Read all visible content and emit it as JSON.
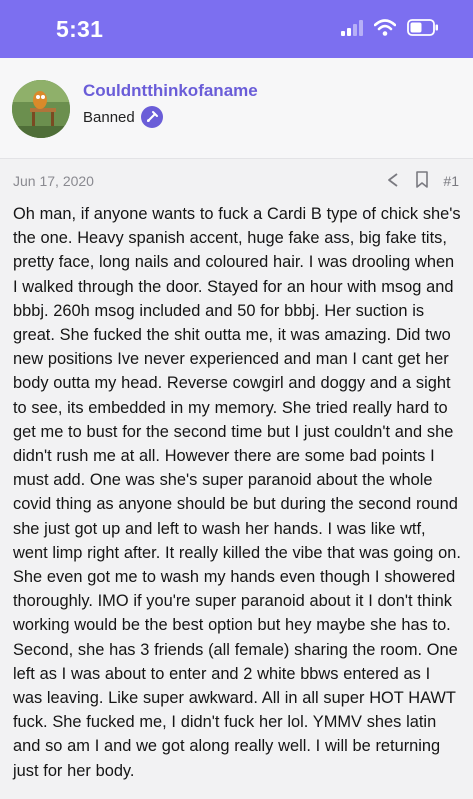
{
  "status_bar": {
    "time": "5:31",
    "icons": [
      "signal-icon",
      "wifi-icon",
      "battery-icon"
    ]
  },
  "profile": {
    "username": "Couldntthinkofaname",
    "role": "Banned",
    "badge_icon": "moderator-badge-icon",
    "accent_color": "#6a5dd8"
  },
  "post": {
    "date": "Jun 17, 2020",
    "post_number": "#1",
    "action_icons": [
      "share-icon",
      "bookmark-icon"
    ],
    "body": "Oh man, if anyone wants to fuck a Cardi B type of chick she's the one. Heavy spanish accent, huge fake ass, big fake tits, pretty face, long nails and coloured hair. I was drooling when I walked through the door. Stayed for an hour with msog and bbbj. 260h msog included and 50 for bbbj. Her suction is great. She fucked the shit outta me, it was amazing. Did two new positions Ive never experienced and man I cant get her body outta my head. Reverse cowgirl and doggy and a sight to see, its embedded in my memory. She tried really hard to get me to bust for the second time but I just couldn't and she didn't rush me at all. However there are some bad points I must add. One was she's super paranoid about the whole covid thing as anyone should be but during the second round she just got up and left to wash her hands. I was like wtf, went limp right after. It really killed the vibe that was going on. She even got me to wash my hands even though I showered thoroughly. IMO if you're super paranoid about it I don't think working would be the best option but hey maybe she has to. Second, she has 3 friends (all female) sharing the room. One left as I was about to enter and 2 white bbws entered as I was leaving. Like super awkward. All in all super HOT HAWT fuck. She fucked me, I didn't fuck her lol. YMMV shes latin and so am I and we got along really well. I will be returning just for her body."
  }
}
